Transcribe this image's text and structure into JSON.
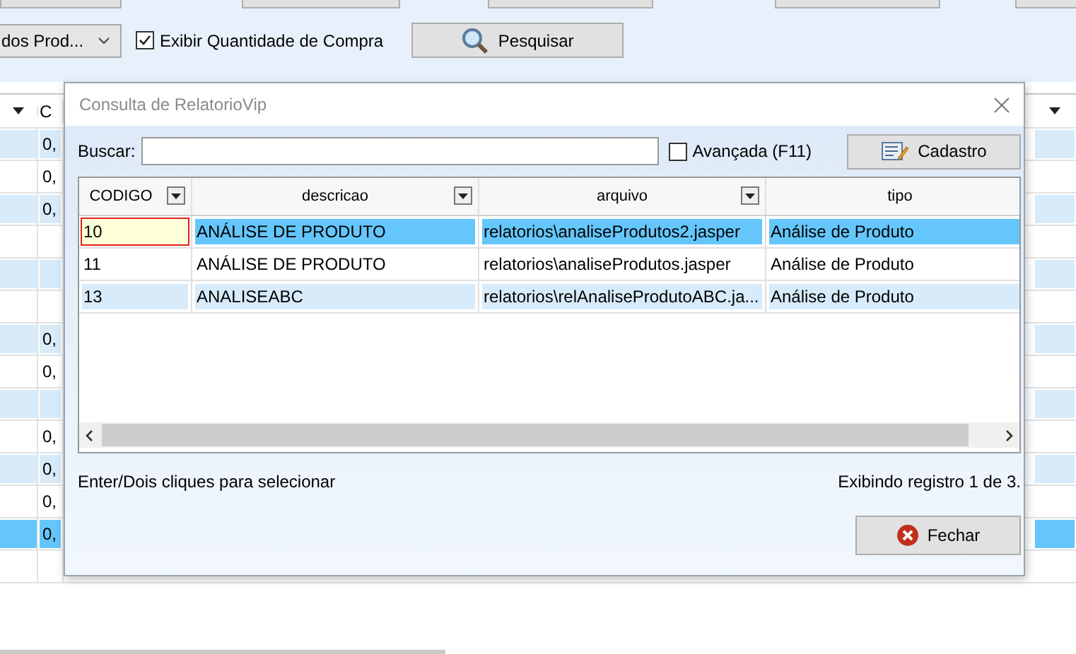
{
  "toolbar": {
    "filter_combo": {
      "value": "dos Prod..."
    },
    "quantity_checkbox": {
      "label": "Exibir Quantidade de Compra",
      "checked": true
    },
    "search_button": {
      "label": "Pesquisar"
    }
  },
  "background_grid": {
    "header": {
      "column_2": "C"
    },
    "rows": [
      {
        "column_2": "0,",
        "selected": false
      },
      {
        "column_2": "0,",
        "selected": false
      },
      {
        "column_2": "0,",
        "selected": false
      },
      {
        "selected": false
      },
      {
        "selected": false
      },
      {
        "selected": false
      },
      {
        "column_2": "0,",
        "selected": false
      },
      {
        "column_2": "0,",
        "selected": false
      },
      {
        "selected": false
      },
      {
        "column_2": "0,",
        "selected": false
      },
      {
        "column_2": "0,",
        "selected": false
      },
      {
        "column_2": "0,",
        "selected": false
      },
      {
        "column_2": "0,",
        "selected": true
      },
      {
        "selected": false
      }
    ]
  },
  "dialog": {
    "title": "Consulta de RelatorioVip",
    "search": {
      "label": "Buscar:"
    },
    "advanced_checkbox": {
      "label": "Avançada (F11)",
      "checked": false
    },
    "register_button": {
      "label": "Cadastro"
    },
    "table": {
      "columns": [
        {
          "label": "CODIGO",
          "filter": true
        },
        {
          "label": "descricao",
          "filter": true
        },
        {
          "label": "arquivo",
          "filter": true
        },
        {
          "label": "tipo",
          "filter": false
        }
      ],
      "rows": [
        {
          "cells": [
            "10",
            "ANÁLISE DE PRODUTO",
            "relatorios\\analiseProdutos2.jasper",
            "Análise de Produto"
          ],
          "selected": true
        },
        {
          "cells": [
            "11",
            "ANÁLISE DE PRODUTO",
            "relatorios\\analiseProdutos.jasper",
            "Análise de Produto"
          ],
          "selected": false
        },
        {
          "cells": [
            "13",
            "ANALISEABC",
            "relatorios\\relAnaliseProdutoABC.ja...",
            "Análise de Produto"
          ],
          "selected": false
        }
      ]
    },
    "hint": "Enter/Dois cliques para selecionar",
    "record_count": "Exibindo registro 1 de 3.",
    "close_button": {
      "label": "Fechar"
    }
  }
}
